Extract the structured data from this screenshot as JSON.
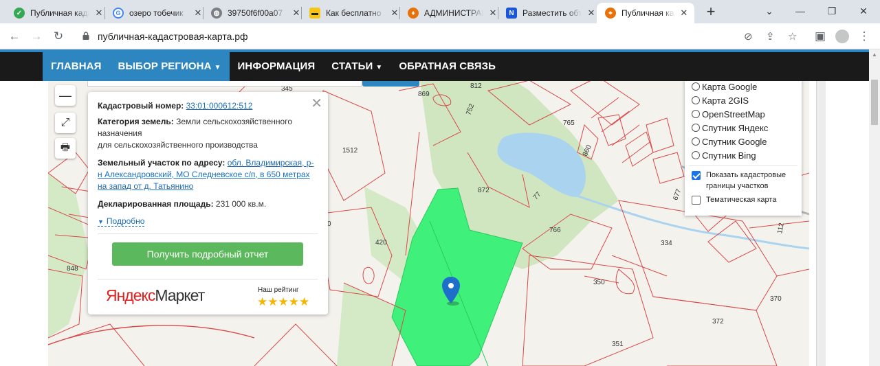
{
  "browser": {
    "tabs": [
      {
        "title": "Публичная кадастровая карта",
        "icon": "green-check-icon",
        "color": "#34a853"
      },
      {
        "title": "озеро тобечик",
        "icon": "google-g-icon",
        "color": "#4285f4"
      },
      {
        "title": "39750f6f00a07",
        "icon": "globe-icon",
        "color": "#5f6368"
      },
      {
        "title": "Как бесплатно",
        "icon": "yellow-site-icon",
        "color": "#f9c513"
      },
      {
        "title": "АДМИНИСТРАЦИЯ",
        "icon": "flame-icon",
        "color": "#e8710a"
      },
      {
        "title": "Разместить объявление",
        "icon": "n-logo-icon",
        "color": "#1a56db"
      },
      {
        "title": "Публичная кадастровая карта",
        "icon": "map-pin-icon",
        "color": "#e8710a",
        "active": true
      }
    ],
    "url": "публичная-кадастровая-карта.рф"
  },
  "site_nav": {
    "items": [
      {
        "label": "ГЛАВНАЯ",
        "highlight": true
      },
      {
        "label": "ВЫБОР РЕГИОНА",
        "highlight": true,
        "dropdown": true
      },
      {
        "label": "ИНФОРМАЦИЯ"
      },
      {
        "label": "СТАТЬИ",
        "dropdown": true
      },
      {
        "label": "ОБРАТНАЯ СВЯЗЬ"
      }
    ],
    "accent": "#2e86c1"
  },
  "popup": {
    "cadastral_label": "Кадастровый номер:",
    "cadastral_value": "33:01:000612:512",
    "category_label": "Категория земель:",
    "category_value_line1": "Земли сельскохозяйственного",
    "category_value_line2": "назначения",
    "category_value_line3": "для сельскохозяйственного производства",
    "address_label": "Земельный участок по адресу:",
    "address_value_line1": "обл. Владимирская, р-",
    "address_value_line2": "н Александровский, МО Следневское с/п, в 650 метрах",
    "address_value_line3": "на запад от д. Татьянино",
    "area_label": "Декларированная площадь:",
    "area_value": "231 000 кв.м.",
    "more_label": "Подробно",
    "report_button": "Получить подробный отчет",
    "market_brand_1": "Яндекс",
    "market_brand_2": "Маркет",
    "rating_label": "Наш рейтинг",
    "rating_stars": 5,
    "button_color": "#5cb85c"
  },
  "layers": {
    "items": [
      "Карта Google",
      "Карта 2GIS",
      "OpenStreetMap",
      "Спутник Яндекс",
      "Спутник Google",
      "Спутник Bing"
    ],
    "show_borders_label": "Показать кадастровые границы участков",
    "show_borders_checked": true,
    "thematic_label": "Тематическая карта",
    "thematic_checked": false
  },
  "map": {
    "parcel_labels": [
      "345",
      "869",
      "812",
      "752",
      "765",
      "860",
      "677",
      "1512",
      "872",
      "77",
      "766",
      "334",
      "112",
      "420",
      "848",
      "350",
      "370",
      "372",
      "351",
      "0"
    ],
    "selected_parcel_color": "#3ff07a",
    "border_color": "#d94848"
  }
}
